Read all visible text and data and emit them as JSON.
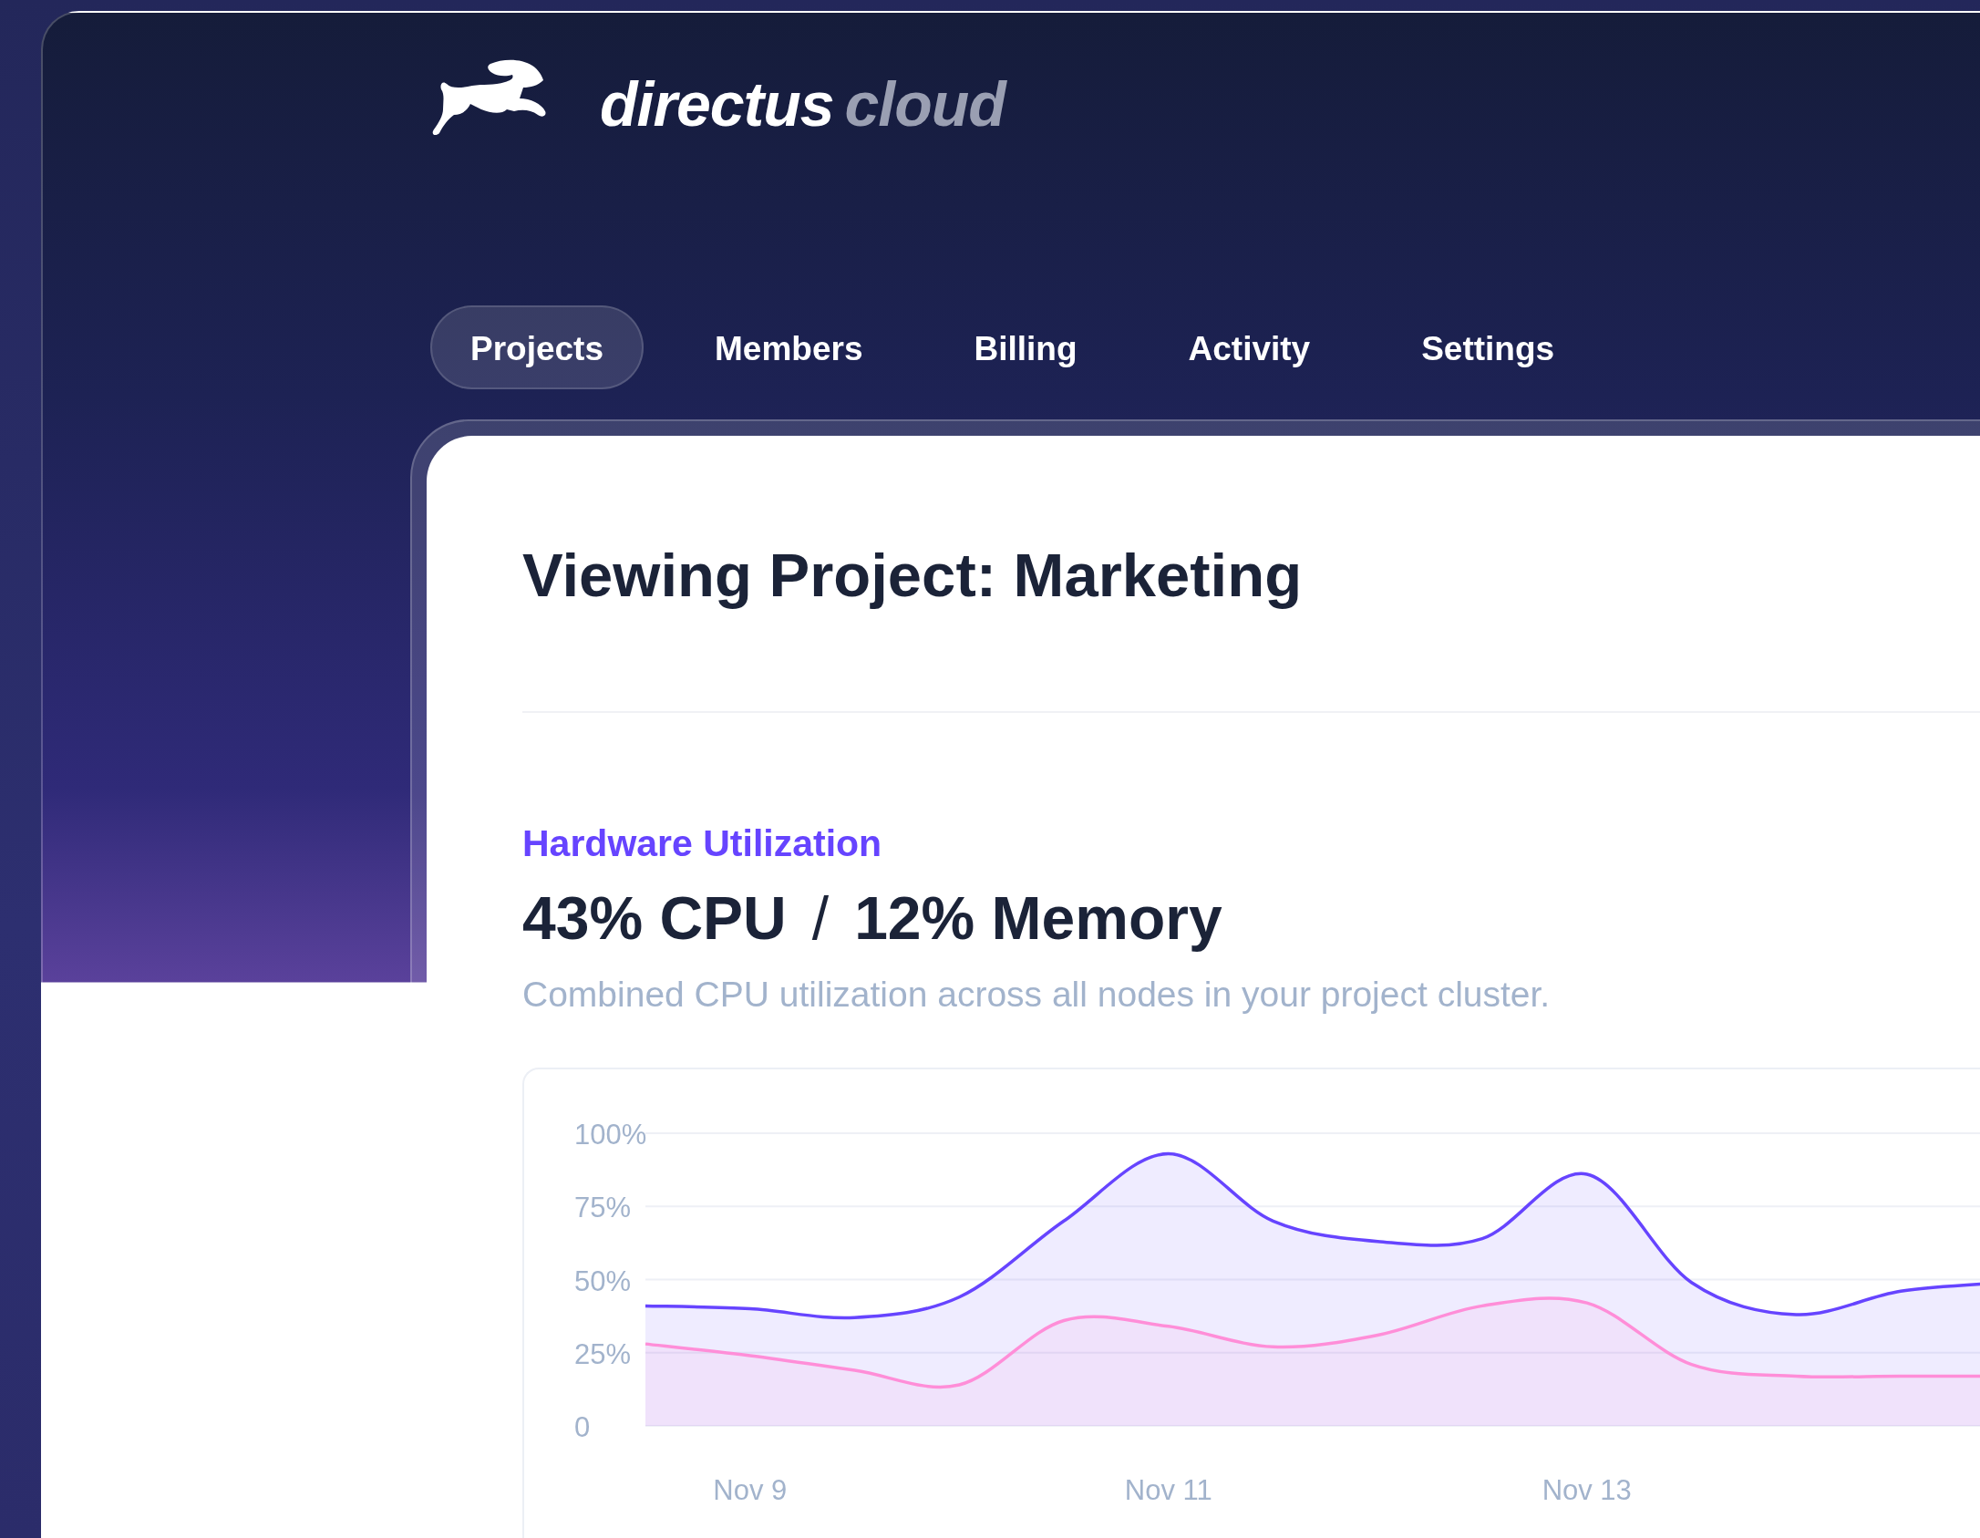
{
  "brand": {
    "name": "directus",
    "product": "cloud"
  },
  "tabs": [
    {
      "label": "Projects",
      "selected": true
    },
    {
      "label": "Members",
      "selected": false
    },
    {
      "label": "Billing",
      "selected": false
    },
    {
      "label": "Activity",
      "selected": false
    },
    {
      "label": "Settings",
      "selected": false
    }
  ],
  "page": {
    "title": "Viewing Project: Marketing"
  },
  "utilization": {
    "heading": "Hardware Utilization",
    "cpu": "43% CPU",
    "separator": "/",
    "memory": "12% Memory",
    "description": "Combined CPU utilization across all nodes in your project cluster.",
    "chart_data": {
      "type": "area",
      "categories": [
        null,
        "Nov 9",
        null,
        null,
        null,
        "Nov 11",
        null,
        null,
        null,
        "Nov 13",
        null,
        null,
        null,
        null
      ],
      "series": [
        {
          "color": "#6644ff",
          "values": [
            41,
            40,
            37,
            44,
            70,
            93,
            70,
            63,
            64,
            86,
            49,
            38,
            46,
            49
          ]
        },
        {
          "color": "#ff8ed8",
          "values": [
            28,
            24,
            19,
            14,
            36,
            34,
            27,
            31,
            41,
            42,
            21,
            17,
            17,
            17
          ]
        }
      ],
      "ylim": [
        0,
        100
      ],
      "grid": true,
      "yticks": [
        {
          "value": 0,
          "label": "0"
        },
        {
          "value": 25,
          "label": "25%"
        },
        {
          "value": 50,
          "label": "50%"
        },
        {
          "value": 75,
          "label": "75%"
        },
        {
          "value": 100,
          "label": "100%"
        }
      ]
    }
  }
}
